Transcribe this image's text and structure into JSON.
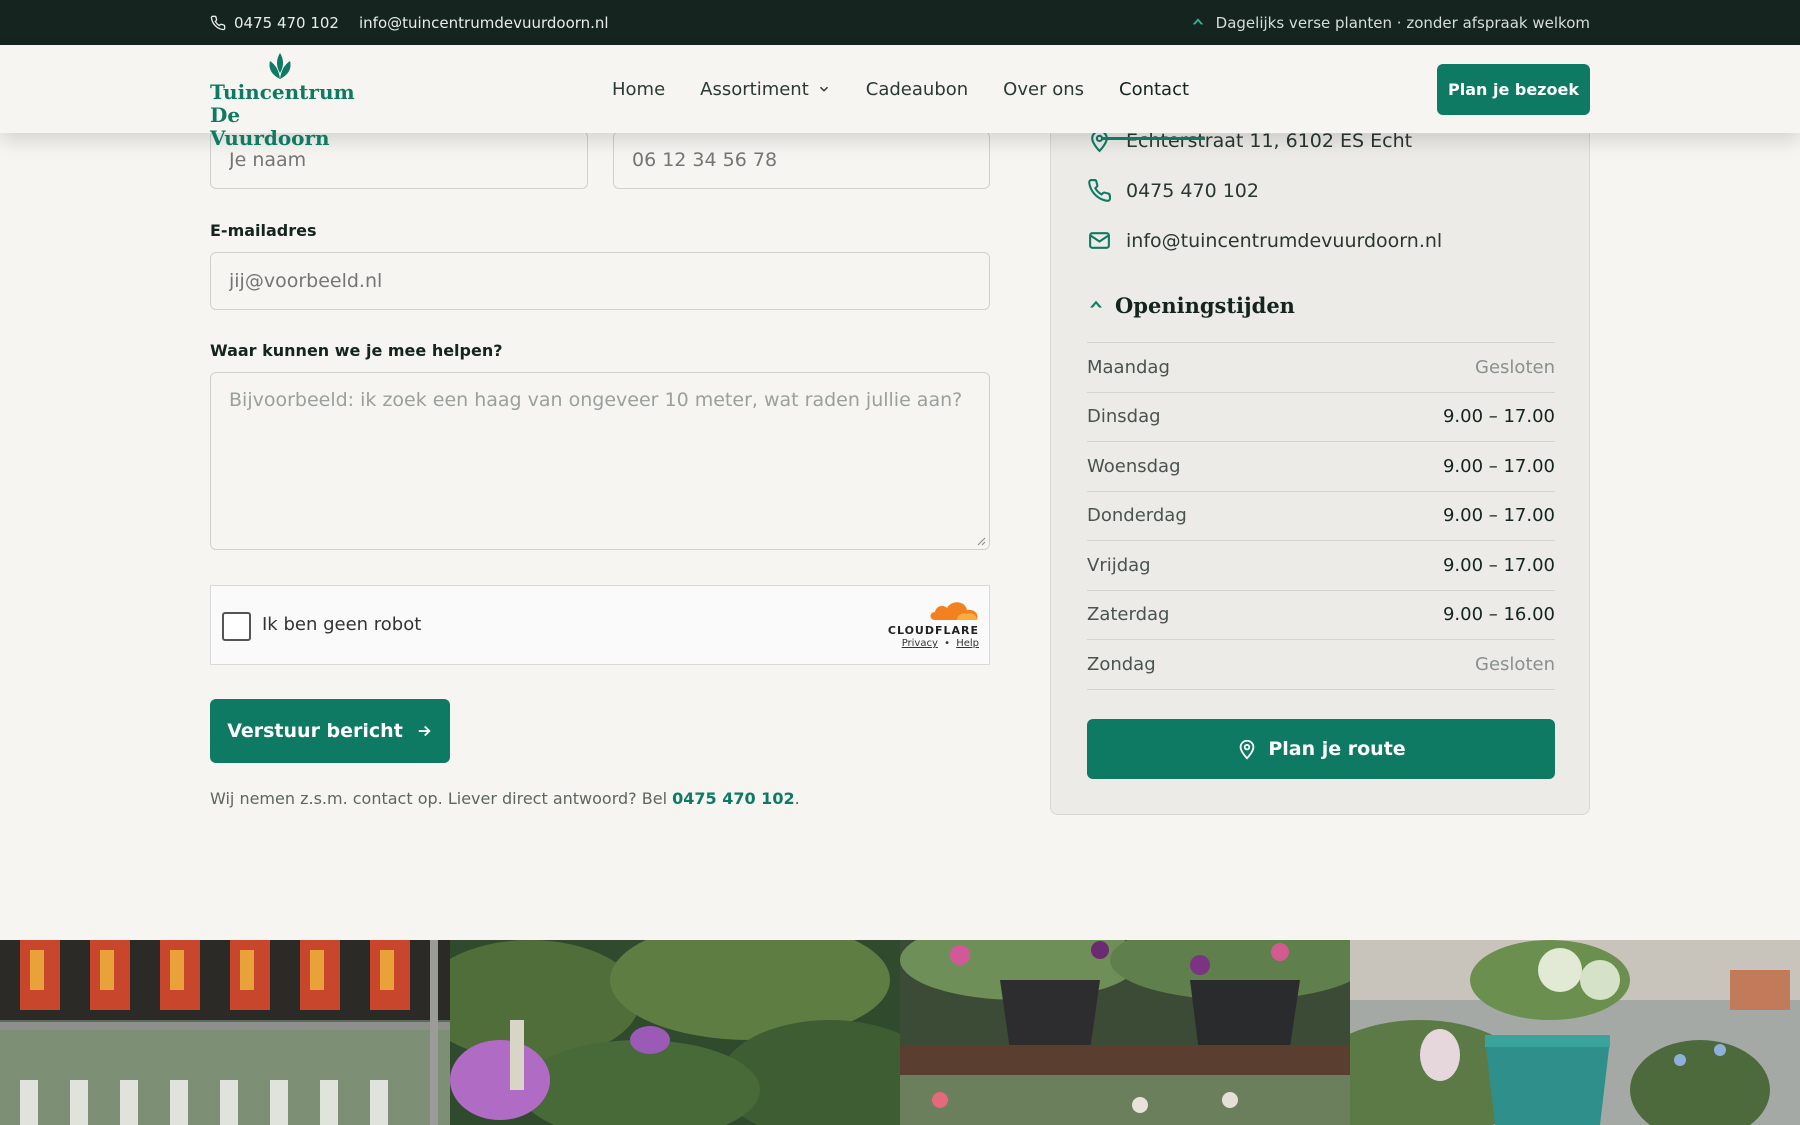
{
  "topbar": {
    "phone": "0475 470 102",
    "email": "info@tuincentrumdevuurdoorn.nl",
    "tagline": "Dagelijks verse planten · zonder afspraak welkom"
  },
  "brand": {
    "line1": "Tuincentrum",
    "line2": "De Vuurdoorn",
    "color": "#0f7a64"
  },
  "nav": {
    "items": [
      {
        "label": "Home"
      },
      {
        "label": "Assortiment"
      },
      {
        "label": "Cadeaubon"
      },
      {
        "label": "Over ons"
      },
      {
        "label": "Contact"
      }
    ],
    "cta": "Plan je bezoek"
  },
  "form": {
    "name_placeholder": "Je naam",
    "phone_placeholder": "06 12 34 56 78",
    "email_label": "E-mailadres",
    "email_placeholder": "jij@voorbeeld.nl",
    "message_label": "Waar kunnen we je mee helpen?",
    "message_placeholder": "Bijvoorbeeld: ik zoek een haag van ongeveer 10 meter, wat raden jullie aan?",
    "captcha_label": "Ik ben geen robot",
    "captcha_brand": "CLOUDFLARE",
    "captcha_privacy": "Privacy",
    "captcha_sep": "•",
    "captcha_help": "Help",
    "submit": "Verstuur bericht",
    "note_prefix": "Wij nemen z.s.m. contact op. Liever direct antwoord? Bel ",
    "note_phone": "0475 470 102",
    "note_suffix": "."
  },
  "contact": {
    "address": "Echterstraat 11, 6102 ES Echt",
    "phone": "0475 470 102",
    "email": "info@tuincentrumdevuurdoorn.nl"
  },
  "hours": {
    "title": "Openingstijden",
    "rows": [
      {
        "day": "Maandag",
        "time": "Gesloten"
      },
      {
        "day": "Dinsdag",
        "time": "9.00 – 17.00"
      },
      {
        "day": "Woensdag",
        "time": "9.00 – 17.00"
      },
      {
        "day": "Donderdag",
        "time": "9.00 – 17.00"
      },
      {
        "day": "Vrijdag",
        "time": "9.00 – 17.00"
      },
      {
        "day": "Zaterdag",
        "time": "9.00 – 16.00"
      },
      {
        "day": "Zondag",
        "time": "Gesloten"
      }
    ],
    "route": "Plan je route"
  },
  "gallery": {
    "photos": [
      "plant-rack-photo",
      "shrubs-photo",
      "flower-pots-photo",
      "hydrangea-photo"
    ]
  }
}
